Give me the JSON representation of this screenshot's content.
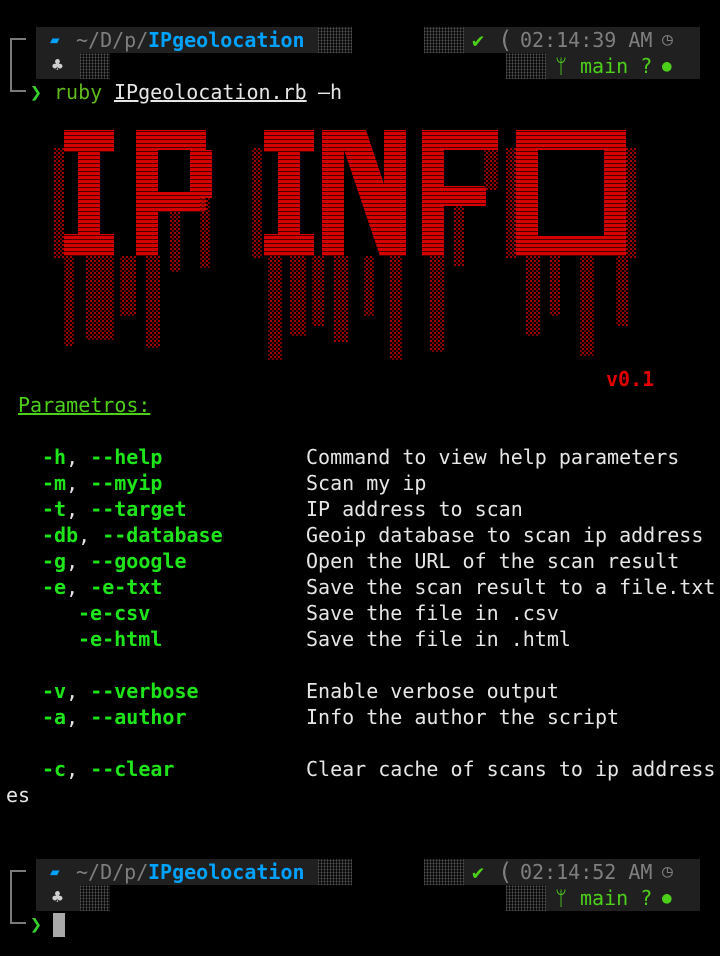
{
  "prompt1": {
    "folder_icon": "folder-icon",
    "path_dim": "~/D/p/",
    "path_dir": "IPgeolocation",
    "status_check": "✔",
    "time": "02:14:39 AM",
    "clock_icon": "clock-icon",
    "os_icon": "android-icon",
    "branch_icon": "git-branch-icon",
    "branch": "main ?",
    "github_icon": "github-icon",
    "prompt_symbol": "❯",
    "command_prefix": "ruby",
    "command_file": "IPgeolocation.rb",
    "command_arg": "–h"
  },
  "banner": {
    "text": "IP INFO",
    "version": "v0.1",
    "color": "#d40000"
  },
  "help": {
    "heading": "Parametros:",
    "rows": [
      {
        "flag": "-h",
        "sep": ", ",
        "long": "--help",
        "desc": "Command to view help parameters"
      },
      {
        "flag": "-m",
        "sep": ", ",
        "long": "--myip",
        "desc": "Scan my ip"
      },
      {
        "flag": "-t",
        "sep": ", ",
        "long": "--target",
        "desc": "IP address to scan"
      },
      {
        "flag": "-db",
        "sep": ", ",
        "long": "--database",
        "desc": "Geoip database to scan ip address"
      },
      {
        "flag": "-g",
        "sep": ", ",
        "long": "--google",
        "desc": "Open the URL of the scan result"
      },
      {
        "flag": "-e",
        "sep": ", ",
        "long": "-e-txt",
        "desc": "Save the scan result to a file.txt"
      },
      {
        "flag": "",
        "sep": "",
        "long": "-e-csv",
        "desc": "Save the file in .csv"
      },
      {
        "flag": "",
        "sep": "",
        "long": "-e-html",
        "desc": "Save the file in .html"
      },
      {
        "flag": "-v",
        "sep": ", ",
        "long": "--verbose",
        "desc": "Enable verbose output"
      },
      {
        "flag": "-a",
        "sep": ", ",
        "long": "--author",
        "desc": "Info the author the script"
      },
      {
        "flag": "-c",
        "sep": ", ",
        "long": "--clear",
        "desc": "Clear cache of scans to ip address"
      }
    ],
    "wrap_tail": "es"
  },
  "prompt2": {
    "path_dim": "~/D/p/",
    "path_dir": "IPgeolocation",
    "status_check": "✔",
    "time": "02:14:52 AM",
    "branch": "main ?",
    "prompt_symbol": "❯"
  },
  "colors": {
    "background": "#000000",
    "flag_green": "#1ee51a",
    "path_blue": "#00a2ff",
    "banner_red": "#d40000"
  }
}
